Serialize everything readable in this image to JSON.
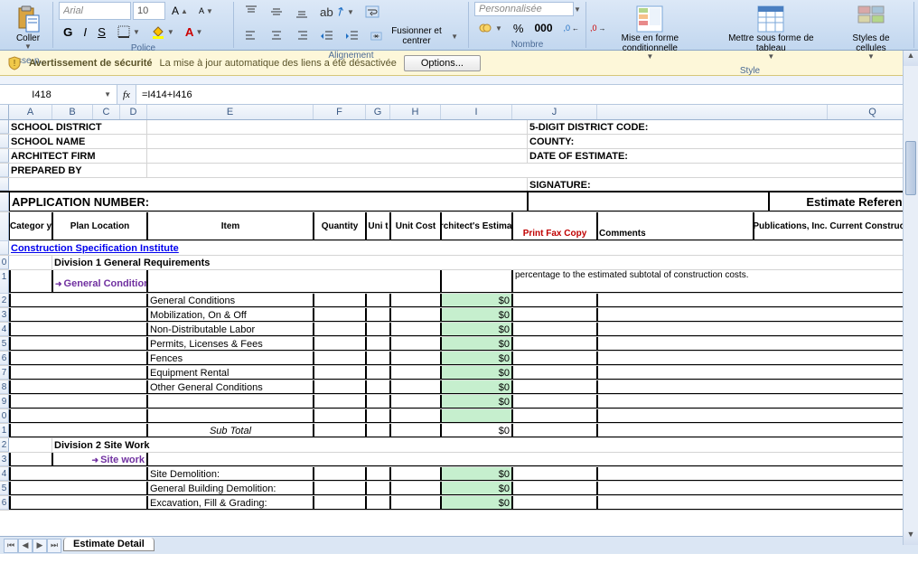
{
  "ribbon": {
    "paste_label": "Coller",
    "clipboard_label": "resse-p...",
    "font_group": "Police",
    "align_group": "Alignement",
    "number_group": "Nombre",
    "style_group": "Style",
    "font_name": "Arial",
    "font_size": "10",
    "merge_label": "Fusionner et centrer",
    "wrap_label": "Renvoyer à la ligne automatiquement",
    "number_format": "Personnalisée",
    "cond_format": "Mise en forme conditionnelle",
    "table_format": "Mettre sous forme de tableau",
    "cell_styles": "Styles de cellules"
  },
  "security": {
    "title": "Avertissement de sécurité",
    "msg": "La mise à jour automatique des liens a été désactivée",
    "options": "Options..."
  },
  "formula": {
    "cellref": "I418",
    "formula": "=I414+I416"
  },
  "colheaders": [
    "A",
    "B",
    "C",
    "D",
    "E",
    "F",
    "G",
    "H",
    "I",
    "J",
    "",
    "",
    "",
    "Q"
  ],
  "rowheaders": [
    "",
    "",
    "",
    "",
    "",
    "",
    "",
    "",
    "",
    "0",
    "1",
    "2",
    "3",
    "4",
    "5",
    "6",
    "7",
    "8",
    "9",
    "0",
    "1",
    "2",
    "3",
    "4",
    "5",
    "6"
  ],
  "labels": {
    "school_district": "SCHOOL DISTRICT",
    "school_name": "SCHOOL NAME",
    "architect_firm": "ARCHITECT FIRM",
    "prepared_by": "PREPARED BY",
    "district_code": "5-DIGIT DISTRICT CODE:",
    "county": "COUNTY:",
    "date_estimate": "DATE OF ESTIMATE:",
    "signature": "SIGNATURE:",
    "app_number": "APPLICATION NUMBER:",
    "est_ref": "Estimate Reference"
  },
  "table_headers": {
    "category": "Categor y",
    "plan_loc": "Plan Location",
    "item": "Item",
    "quantity": "Quantity",
    "unit": "Uni t",
    "unit_cost": "Unit Cost",
    "arch_est": "Architect's Estimate",
    "print_fax": "Print Fax Copy",
    "comments": "Comments",
    "saylor": "Saylor Publications, Inc. Current Construction Costs"
  },
  "sections": {
    "csi": "Construction Specification Institute",
    "div1": "Division 1 General Requirements",
    "gen_cond": "General Conditions",
    "div2": "Division 2 Site Work",
    "site_work": "Site work",
    "subtotal": "Sub Total",
    "pct_note": "percentage to the estimated subtotal of construction costs."
  },
  "items_div1": [
    "General Conditions",
    "Mobilization, On & Off",
    "Non-Distributable Labor",
    "Permits, Licenses & Fees",
    "Fences",
    "Equipment Rental",
    "Other General Conditions"
  ],
  "items_div2": [
    "Site Demolition:",
    "General Building Demolition:",
    "Excavation, Fill & Grading:"
  ],
  "zero": "$0",
  "tab_name": "Estimate Detail"
}
